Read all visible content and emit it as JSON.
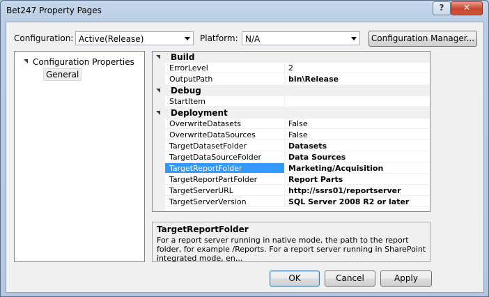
{
  "window": {
    "title": "Bet247 Property Pages"
  },
  "titlebar": {
    "help_label": "?",
    "close_label": "✕"
  },
  "config": {
    "configuration_label": "Configuration:",
    "configuration_value": "Active(Release)",
    "platform_label": "Platform:",
    "platform_value": "N/A",
    "manager_button": "Configuration Manager..."
  },
  "tree": {
    "root": "Configuration Properties",
    "child": "General"
  },
  "grid": {
    "categories": {
      "build": "Build",
      "debug": "Debug",
      "deployment": "Deployment"
    },
    "props": {
      "error_level": {
        "name": "ErrorLevel",
        "value": "2"
      },
      "output_path": {
        "name": "OutputPath",
        "value": "bin\\Release"
      },
      "start_item": {
        "name": "StartItem",
        "value": ""
      },
      "overwrite_datasets": {
        "name": "OverwriteDatasets",
        "value": "False"
      },
      "overwrite_datasources": {
        "name": "OverwriteDataSources",
        "value": "False"
      },
      "target_dataset_folder": {
        "name": "TargetDatasetFolder",
        "value": "Datasets"
      },
      "target_datasource_folder": {
        "name": "TargetDataSourceFolder",
        "value": "Data Sources"
      },
      "target_report_folder": {
        "name": "TargetReportFolder",
        "value": "Marketing/Acquisition"
      },
      "target_reportpart_folder": {
        "name": "TargetReportPartFolder",
        "value": "Report Parts"
      },
      "target_server_url": {
        "name": "TargetServerURL",
        "value": "http://ssrs01/reportserver"
      },
      "target_server_version": {
        "name": "TargetServerVersion",
        "value": "SQL Server 2008 R2 or later"
      }
    }
  },
  "description": {
    "title": "TargetReportFolder",
    "text": "For a report server running in native mode, the path to the report folder, for example /Reports. For a report server running in SharePoint integrated mode, en..."
  },
  "buttons": {
    "ok": "OK",
    "cancel": "Cancel",
    "apply": "Apply"
  },
  "colors": {
    "selection": "#3399ff",
    "title_gradient": "#b9cde4"
  }
}
